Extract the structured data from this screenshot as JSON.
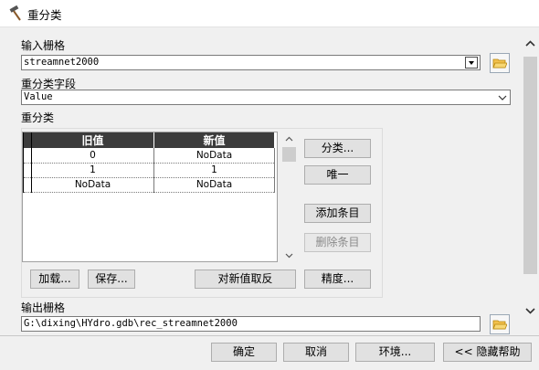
{
  "window": {
    "title": "重分类"
  },
  "input_raster": {
    "label": "输入栅格",
    "value": "streamnet2000"
  },
  "reclass_field": {
    "label": "重分类字段",
    "value": "Value"
  },
  "reclass_section": {
    "label": "重分类"
  },
  "table": {
    "headers": [
      "旧值",
      "新值"
    ],
    "rows": [
      {
        "old": "0",
        "new": "NoData"
      },
      {
        "old": "1",
        "new": "1"
      },
      {
        "old": "NoData",
        "new": "NoData"
      }
    ]
  },
  "side_buttons": {
    "classify": "分类...",
    "unique": "唯一",
    "add_entry": "添加条目",
    "delete_entry": "删除条目"
  },
  "bottom_buttons": {
    "load": "加载...",
    "save": "保存...",
    "reverse": "对新值取反",
    "precision": "精度..."
  },
  "output_raster": {
    "label": "输出栅格",
    "value": "G:\\dixing\\HYdro.gdb\\rec_streamnet2000"
  },
  "footer": {
    "ok": "确定",
    "cancel": "取消",
    "env": "环境...",
    "hide_help": "<< 隐藏帮助"
  },
  "icons": {
    "title": "hammer-icon",
    "browse": "open-folder-icon"
  },
  "colors": {
    "header_bg": "#3c3c3c",
    "panel_bg": "#f0f0f0",
    "folder_yellow": "#f2c14e"
  }
}
